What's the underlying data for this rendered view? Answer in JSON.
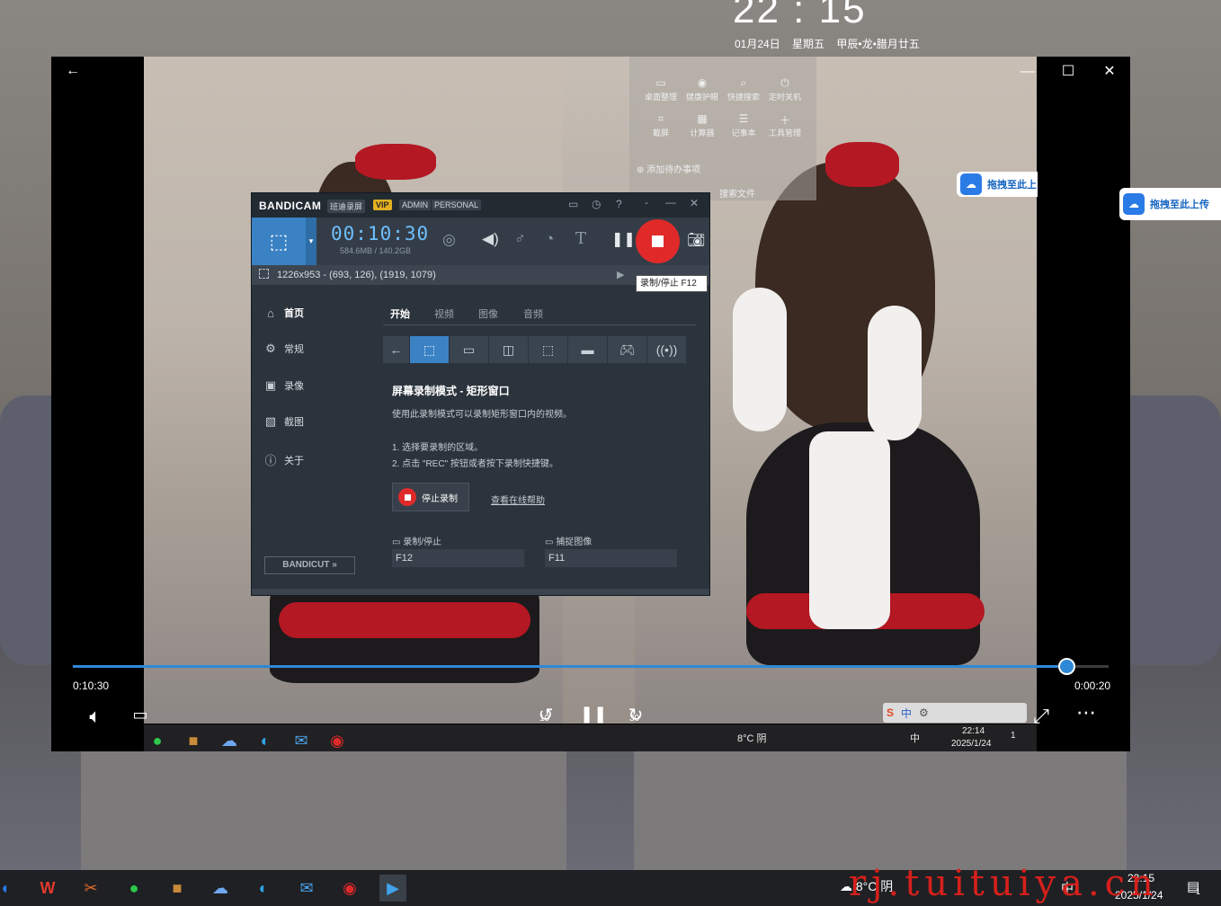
{
  "lockscreen": {
    "time": "22 : 15",
    "date": "01月24日  星期五  甲辰•龙•腊月廿五"
  },
  "player": {
    "back_icon": "arrow-left-icon",
    "window_controls": {
      "minimize": "—",
      "maximize": "☐",
      "close": "✕"
    },
    "elapsed": "0:10:30",
    "remaining": "0:00:20",
    "progress": 0.96,
    "controls": {
      "rewind_label": "10",
      "forward_label": "30"
    }
  },
  "quick_tools": {
    "items": [
      {
        "label": "桌面整理",
        "icon": "desktop-icon"
      },
      {
        "label": "健康护眼",
        "icon": "eye-icon"
      },
      {
        "label": "快捷搜索",
        "icon": "search-icon"
      },
      {
        "label": "定时关机",
        "icon": "power-icon"
      },
      {
        "label": "截屏",
        "icon": "crop-icon"
      },
      {
        "label": "计算器",
        "icon": "calculator-icon"
      },
      {
        "label": "记事本",
        "icon": "notepad-icon"
      },
      {
        "label": "工具管理",
        "icon": "plus-icon"
      }
    ],
    "add_todo": "添加待办事项",
    "search_file": "搜索文件"
  },
  "baidu": {
    "label": "拖拽至此上传",
    "label_small": "拖拽至此上"
  },
  "bandicam": {
    "brand": "BANDICAM",
    "brand_cn": "班迪录屏",
    "badges": [
      "VIP",
      "ADMIN",
      "PERSONAL"
    ],
    "timer": "00:10:30",
    "size": "584.6MB / 140.2GB",
    "region_info": "1226x953 - (693, 126), (1919, 1079)",
    "tooltip": "录制/停止   F12",
    "sidebar": [
      {
        "label": "首页",
        "icon": "home-icon"
      },
      {
        "label": "常规",
        "icon": "gear-icon"
      },
      {
        "label": "录像",
        "icon": "video-icon"
      },
      {
        "label": "截图",
        "icon": "image-icon"
      },
      {
        "label": "关于",
        "icon": "info-icon"
      }
    ],
    "bandicut": "BANDICUT",
    "tabs": [
      "开始",
      "视频",
      "图像",
      "音频"
    ],
    "mode_title": "屏幕录制模式 - 矩形窗口",
    "mode_desc": "使用此录制模式可以录制矩形窗口内的视频。",
    "steps": [
      "1. 选择要录制的区域。",
      "2. 点击 \"REC\" 按钮或者按下录制快捷键。"
    ],
    "stop_button": "停止录制",
    "help_link": "查看在线帮助",
    "hotkeys": [
      {
        "label": "录制/停止",
        "value": "F12"
      },
      {
        "label": "捕捉图像",
        "value": "F11"
      }
    ]
  },
  "inner_taskbar": {
    "weather": "8°C 阴",
    "time": "22:14",
    "date": "2025/1/24",
    "ime": "中",
    "badge": "1"
  },
  "taskbar": {
    "weather": "8°C 阴",
    "time": "22:15",
    "date": "2025/1/24",
    "ime": "中",
    "badge": "1"
  },
  "watermark": "rj.tuituiya.cn",
  "colors": {
    "accent": "#2f88d6",
    "rec_red": "#e02a2a",
    "bandicam_bg": "#2b333c"
  }
}
